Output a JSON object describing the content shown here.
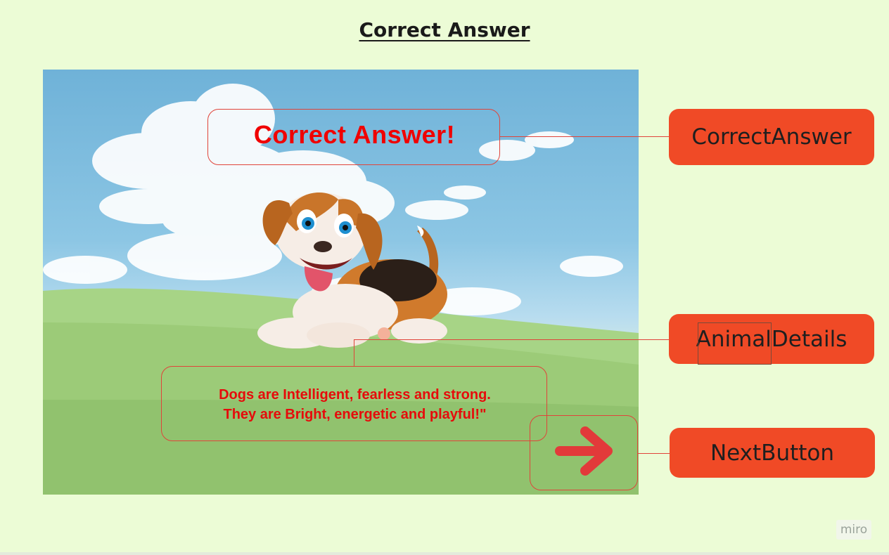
{
  "page": {
    "title": "Correct Answer"
  },
  "scene": {
    "correct_answer_text": "Correct Answer!",
    "details_line_1": "Dogs are Intelligent, fearless and strong.",
    "details_line_2": "They are Bright, energetic and playful!\""
  },
  "labels": {
    "correct_answer": "CorrectAnswer",
    "animal_details": "AnimalDetails",
    "next_button": "NextButton"
  },
  "watermark": "miro",
  "icons": {
    "next": "right-arrow-icon",
    "dog": "beagle-illustration"
  },
  "colors": {
    "background": "#ecfcd6",
    "label": "#f04a26",
    "accent_text": "#f00000",
    "outline": "#e0443a"
  }
}
